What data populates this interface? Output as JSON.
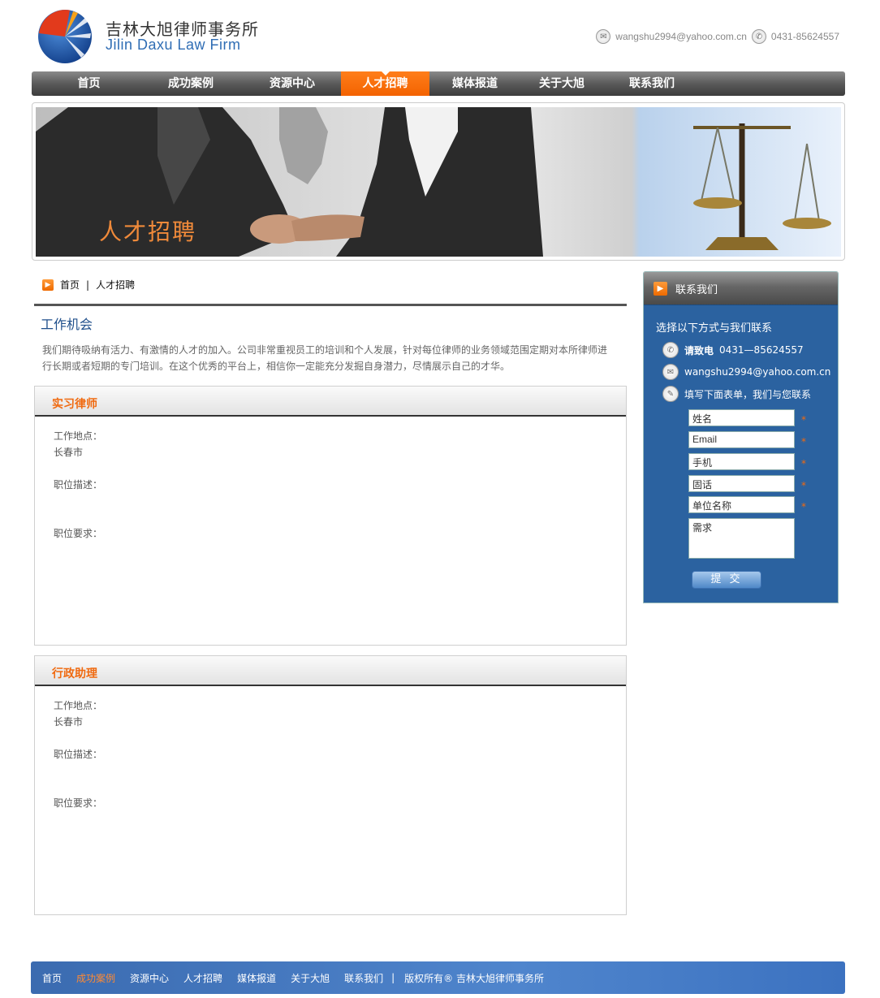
{
  "header": {
    "brand_cn": "吉林大旭律师事务所",
    "brand_en": "Jilin Daxu Law Firm",
    "email": "wangshu2994@yahoo.com.cn",
    "phone": "0431-85624557"
  },
  "nav": {
    "items": [
      "首页",
      "成功案例",
      "资源中心",
      "人才招聘",
      "媒体报道",
      "关于大旭",
      "联系我们"
    ],
    "active": "人才招聘",
    "accent": "#f36200"
  },
  "banner": {
    "title": "人才招聘"
  },
  "breadcrumb": {
    "home": "首页",
    "separator": "|",
    "current": "人才招聘"
  },
  "main": {
    "title": "工作机会",
    "intro": "我们期待吸纳有活力、有激情的人才的加入。公司非常重视员工的培训和个人发展，针对每位律师的业务领域范围定期对本所律师进行长期或者短期的专门培训。在这个优秀的平台上，相信你一定能充分发掘自身潜力，尽情展示自己的才华。",
    "jobs": [
      {
        "title": "实习律师",
        "location_label": "工作地点：",
        "location": "长春市",
        "desc_label": "职位描述：",
        "req_label": "职位要求："
      },
      {
        "title": "行政助理",
        "location_label": "工作地点：",
        "location": "长春市",
        "desc_label": "职位描述：",
        "req_label": "职位要求："
      }
    ]
  },
  "sidebar": {
    "title": "联系我们",
    "intro": "选择以下方式与我们联系",
    "phone_label": "请致电",
    "phone": "0431—85624557",
    "email": "wangshu2994@yahoo.com.cn",
    "form_label": "填写下面表单，我们与您联系",
    "fields": [
      "姓名",
      "Email",
      "手机",
      "固话",
      "单位名称"
    ],
    "required_mark": "*",
    "textarea": "需求",
    "submit": "提 交",
    "bg": "#2b62a0"
  },
  "footer": {
    "links": [
      "首页",
      "成功案例",
      "资源中心",
      "人才招聘",
      "媒体报道",
      "关于大旭",
      "联系我们"
    ],
    "active": "成功案例",
    "separator": "|",
    "copyright": "版权所有® 吉林大旭律师事务所"
  }
}
